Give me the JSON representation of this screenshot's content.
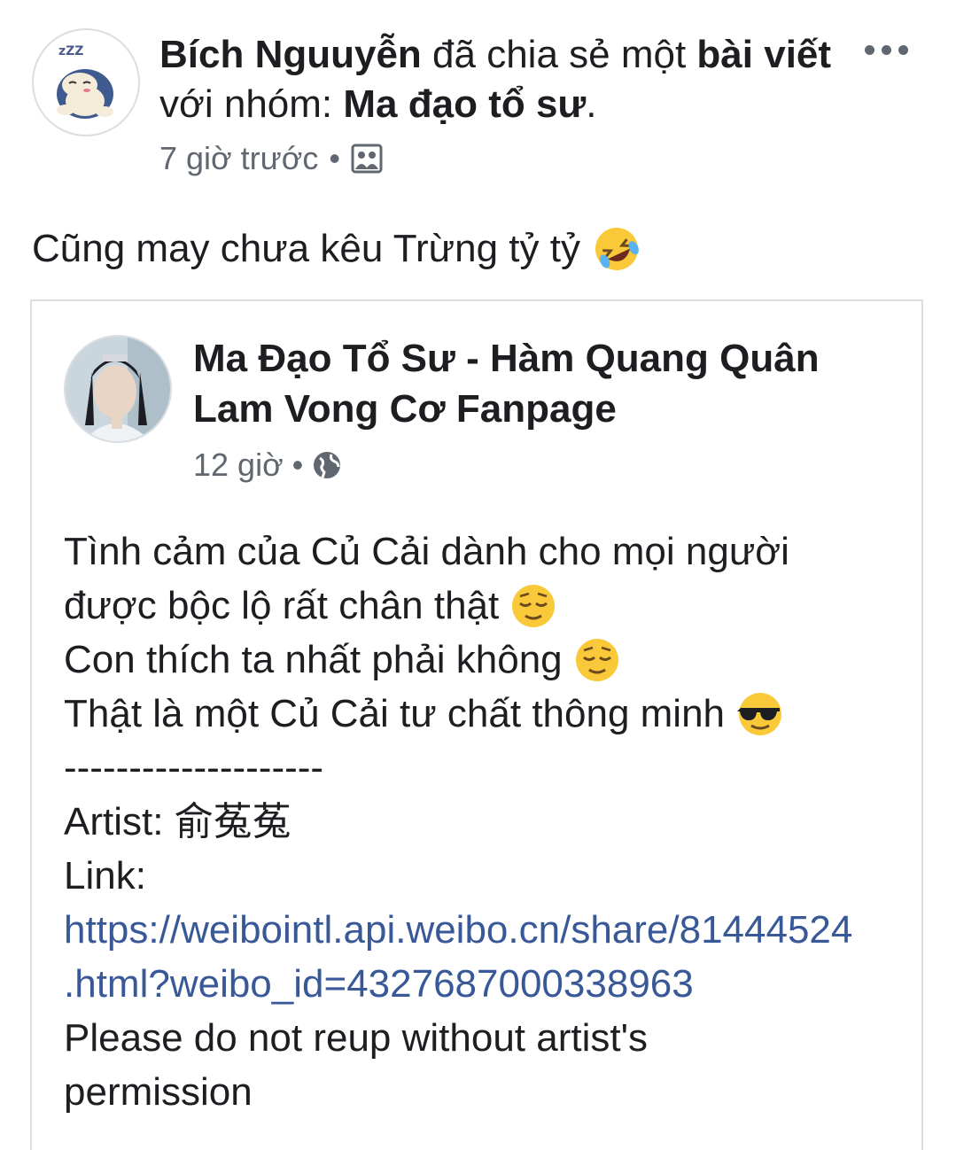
{
  "post": {
    "author": "Bích Nguuyễn",
    "action_text": "đã chia sẻ một",
    "object_text": "bài viết",
    "group_prefix": "với nhóm:",
    "group_name": "Ma đạo tổ sư",
    "period": ".",
    "timestamp": "7 giờ trước",
    "separator": "•",
    "audience_icon": "group-audience-icon",
    "caption": "Cũng may chưa kêu Trừng tỷ tỷ",
    "caption_emoji": "rolling-on-floor-laughing-emoji"
  },
  "shared_post": {
    "page_name_line1": "Ma Đạo Tổ Sư - Hàm Quang Quân",
    "page_name_line2": "Lam Vong Cơ Fanpage",
    "timestamp": "12 giờ",
    "separator": "•",
    "audience_icon": "globe-icon",
    "lines": {
      "l1": "Tình cảm của Củ Cải dành cho mọi người",
      "l2": "được bộc lộ rất chân thật",
      "l3": "Con thích ta nhất phải không",
      "l4": "Thật là một Củ Cải tư chất thông minh",
      "l5": "--------------------",
      "l6": "Artist: 俞菟菟",
      "l7": "Link:",
      "l8": "https://weibointl.api.weibo.cn/share/81444524",
      "l9": ".html?weibo_id=4327687000338963",
      "l10": "Please do not reup without artist's",
      "l11": "permission"
    }
  },
  "colors": {
    "text": "#1c1e21",
    "secondary": "#606770",
    "link": "#385898",
    "border": "#dadde1"
  }
}
